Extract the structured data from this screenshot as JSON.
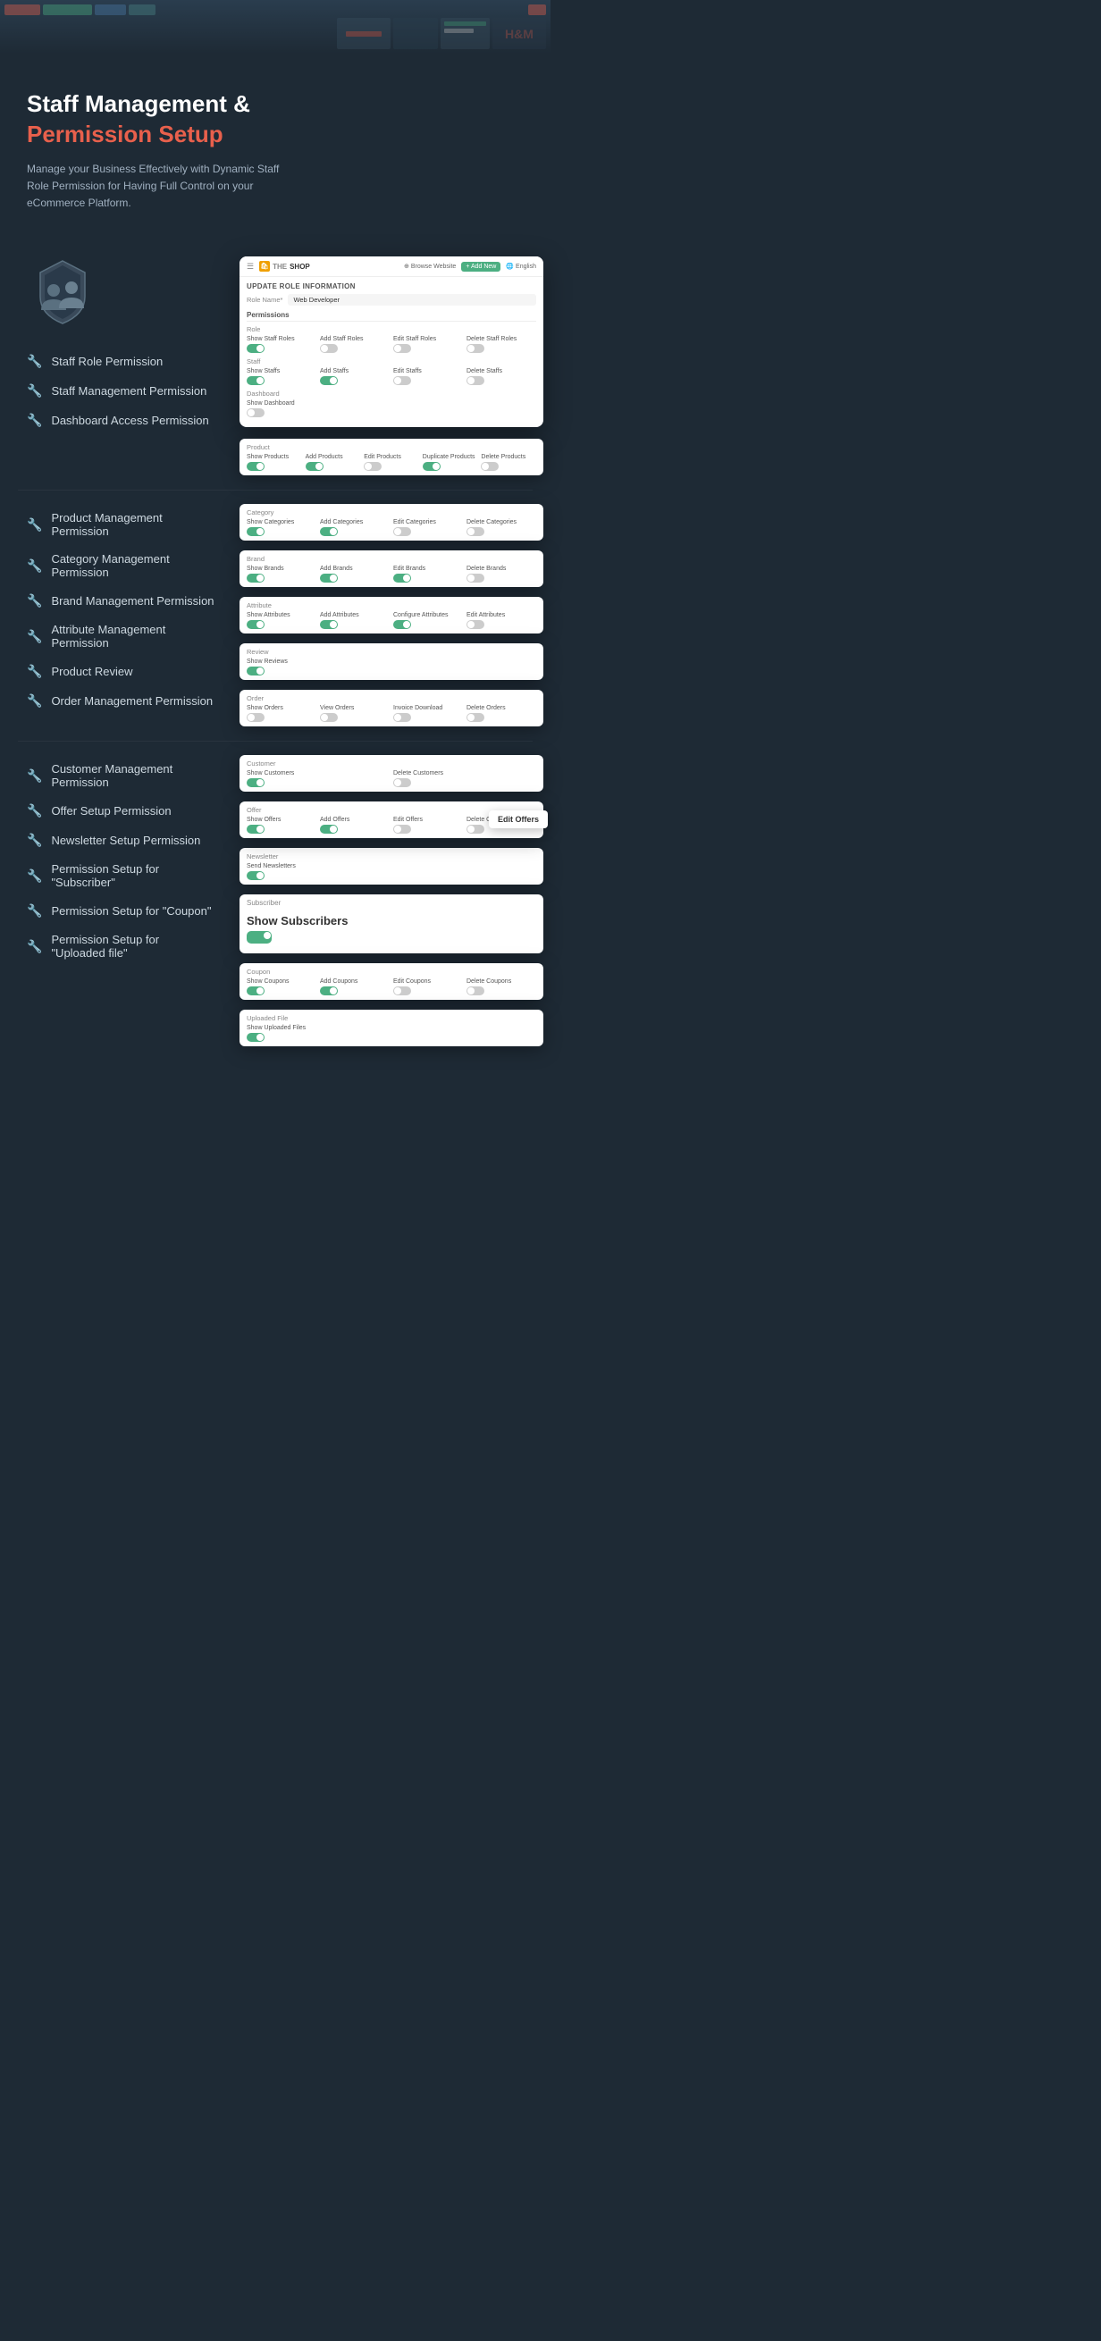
{
  "hero": {
    "title_line1": "Staff Management &",
    "title_line2": "Permission Setup",
    "description": "Manage your Business Effectively with Dynamic Staff Role Permission for Having Full Control on your eCommerce Platform."
  },
  "admin": {
    "logo": "THE SHOP",
    "logo_icon": "🛍",
    "topbar": {
      "browse": "Browse Website",
      "add_new": "+ Add New",
      "lang": "English"
    },
    "update_role_title": "Update Role Information",
    "role_name_label": "Role Name*",
    "role_name_value": "Web Developer",
    "permissions_title": "Permissions"
  },
  "features_top": [
    {
      "label": "Staff Role Permission"
    },
    {
      "label": "Staff Management Permission"
    },
    {
      "label": "Dashboard Access Permission"
    }
  ],
  "features_bottom": [
    {
      "label": "Product Management Permission"
    },
    {
      "label": "Category Management Permission"
    },
    {
      "label": "Brand Management Permission"
    },
    {
      "label": "Attribute Management Permission"
    },
    {
      "label": "Product Review"
    },
    {
      "label": "Order Management Permission"
    }
  ],
  "features_bottom2": [
    {
      "label": "Customer Management Permission"
    },
    {
      "label": "Offer Setup Permission"
    },
    {
      "label": "Newsletter Setup Permission"
    },
    {
      "label": "Permission Setup for \"Subscriber\""
    },
    {
      "label": "Permission Setup for \"Coupon\""
    },
    {
      "label": "Permission Setup for \"Uploaded file\""
    }
  ],
  "perm_sections": {
    "role": {
      "label": "Role",
      "items": [
        {
          "name": "Show Staff Roles",
          "on": true
        },
        {
          "name": "Add Staff Roles",
          "on": false
        },
        {
          "name": "Edit Staff Roles",
          "on": false
        },
        {
          "name": "Delete Staff Roles",
          "on": false
        }
      ]
    },
    "staff": {
      "label": "Staff",
      "items": [
        {
          "name": "Show Staffs",
          "on": true
        },
        {
          "name": "Add Staffs",
          "on": true
        },
        {
          "name": "Edit Staffs",
          "on": false
        },
        {
          "name": "Delete Staffs",
          "on": false
        }
      ]
    },
    "dashboard": {
      "label": "Dashboard",
      "items": [
        {
          "name": "Show Dashboard",
          "on": false
        }
      ]
    },
    "product": {
      "label": "Product",
      "items": [
        {
          "name": "Show Products",
          "on": true
        },
        {
          "name": "Add Products",
          "on": true
        },
        {
          "name": "Edit Products",
          "on": false
        },
        {
          "name": "Duplicate Products",
          "on": true
        },
        {
          "name": "Delete Products",
          "on": false
        }
      ]
    },
    "category": {
      "label": "Category",
      "items": [
        {
          "name": "Show Categories",
          "on": true
        },
        {
          "name": "Add Categories",
          "on": true
        },
        {
          "name": "Edit Categories",
          "on": false
        },
        {
          "name": "Delete Categories",
          "on": false
        }
      ]
    },
    "brand": {
      "label": "Brand",
      "items": [
        {
          "name": "Show Brands",
          "on": true
        },
        {
          "name": "Add Brands",
          "on": true
        },
        {
          "name": "Edit Brands",
          "on": true
        },
        {
          "name": "Delete Brands",
          "on": false
        }
      ]
    },
    "attribute": {
      "label": "Attribute",
      "items": [
        {
          "name": "Show Attributes",
          "on": true
        },
        {
          "name": "Add Attributes",
          "on": true
        },
        {
          "name": "Configure Attributes",
          "on": true
        },
        {
          "name": "Edit Attributes",
          "on": false
        }
      ]
    },
    "review": {
      "label": "Review",
      "items": [
        {
          "name": "Show Reviews",
          "on": true
        }
      ]
    },
    "order": {
      "label": "Order",
      "items": [
        {
          "name": "Show Orders",
          "on": false
        },
        {
          "name": "View Orders",
          "on": false
        },
        {
          "name": "Invoice Download",
          "on": false
        },
        {
          "name": "Delete Orders",
          "on": false
        }
      ]
    },
    "customer": {
      "label": "Customer",
      "items": [
        {
          "name": "Show Customers",
          "on": true
        },
        {
          "name": "Delete Customers",
          "on": false
        }
      ]
    },
    "offer": {
      "label": "Offer",
      "items": [
        {
          "name": "Show Offers",
          "on": true
        },
        {
          "name": "Add Offers",
          "on": true
        },
        {
          "name": "Edit Offers",
          "on": false
        },
        {
          "name": "Delete Offers",
          "on": false
        }
      ]
    },
    "newsletter": {
      "label": "Newsletter",
      "items": [
        {
          "name": "Send Newsletters",
          "on": true
        }
      ]
    },
    "subscriber": {
      "label": "Subscriber",
      "title": "Show Subscribers",
      "items": [
        {
          "name": "Show Subscribers",
          "on": true
        }
      ]
    },
    "coupon": {
      "label": "Coupon",
      "items": [
        {
          "name": "Show Coupons",
          "on": true
        },
        {
          "name": "Add Coupons",
          "on": true
        },
        {
          "name": "Edit Coupons",
          "on": false
        },
        {
          "name": "Delete Coupons",
          "on": false
        }
      ]
    },
    "uploaded_file": {
      "label": "Uploaded File",
      "items": [
        {
          "name": "Show Uploaded Files",
          "on": true
        }
      ]
    }
  },
  "tooltip": {
    "text": "Edit Offers"
  }
}
